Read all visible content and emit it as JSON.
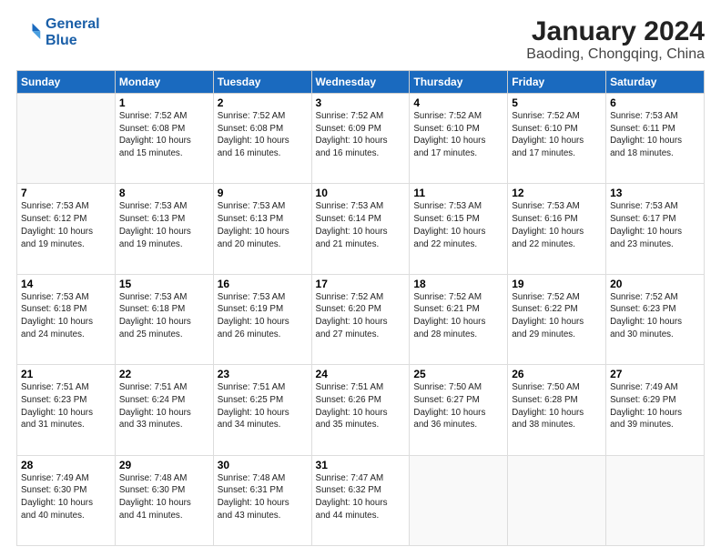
{
  "logo": {
    "line1": "General",
    "line2": "Blue"
  },
  "title": "January 2024",
  "subtitle": "Baoding, Chongqing, China",
  "weekdays": [
    "Sunday",
    "Monday",
    "Tuesday",
    "Wednesday",
    "Thursday",
    "Friday",
    "Saturday"
  ],
  "weeks": [
    [
      {
        "day": "",
        "info": ""
      },
      {
        "day": "1",
        "info": "Sunrise: 7:52 AM\nSunset: 6:08 PM\nDaylight: 10 hours\nand 15 minutes."
      },
      {
        "day": "2",
        "info": "Sunrise: 7:52 AM\nSunset: 6:08 PM\nDaylight: 10 hours\nand 16 minutes."
      },
      {
        "day": "3",
        "info": "Sunrise: 7:52 AM\nSunset: 6:09 PM\nDaylight: 10 hours\nand 16 minutes."
      },
      {
        "day": "4",
        "info": "Sunrise: 7:52 AM\nSunset: 6:10 PM\nDaylight: 10 hours\nand 17 minutes."
      },
      {
        "day": "5",
        "info": "Sunrise: 7:52 AM\nSunset: 6:10 PM\nDaylight: 10 hours\nand 17 minutes."
      },
      {
        "day": "6",
        "info": "Sunrise: 7:53 AM\nSunset: 6:11 PM\nDaylight: 10 hours\nand 18 minutes."
      }
    ],
    [
      {
        "day": "7",
        "info": "Sunrise: 7:53 AM\nSunset: 6:12 PM\nDaylight: 10 hours\nand 19 minutes."
      },
      {
        "day": "8",
        "info": "Sunrise: 7:53 AM\nSunset: 6:13 PM\nDaylight: 10 hours\nand 19 minutes."
      },
      {
        "day": "9",
        "info": "Sunrise: 7:53 AM\nSunset: 6:13 PM\nDaylight: 10 hours\nand 20 minutes."
      },
      {
        "day": "10",
        "info": "Sunrise: 7:53 AM\nSunset: 6:14 PM\nDaylight: 10 hours\nand 21 minutes."
      },
      {
        "day": "11",
        "info": "Sunrise: 7:53 AM\nSunset: 6:15 PM\nDaylight: 10 hours\nand 22 minutes."
      },
      {
        "day": "12",
        "info": "Sunrise: 7:53 AM\nSunset: 6:16 PM\nDaylight: 10 hours\nand 22 minutes."
      },
      {
        "day": "13",
        "info": "Sunrise: 7:53 AM\nSunset: 6:17 PM\nDaylight: 10 hours\nand 23 minutes."
      }
    ],
    [
      {
        "day": "14",
        "info": "Sunrise: 7:53 AM\nSunset: 6:18 PM\nDaylight: 10 hours\nand 24 minutes."
      },
      {
        "day": "15",
        "info": "Sunrise: 7:53 AM\nSunset: 6:18 PM\nDaylight: 10 hours\nand 25 minutes."
      },
      {
        "day": "16",
        "info": "Sunrise: 7:53 AM\nSunset: 6:19 PM\nDaylight: 10 hours\nand 26 minutes."
      },
      {
        "day": "17",
        "info": "Sunrise: 7:52 AM\nSunset: 6:20 PM\nDaylight: 10 hours\nand 27 minutes."
      },
      {
        "day": "18",
        "info": "Sunrise: 7:52 AM\nSunset: 6:21 PM\nDaylight: 10 hours\nand 28 minutes."
      },
      {
        "day": "19",
        "info": "Sunrise: 7:52 AM\nSunset: 6:22 PM\nDaylight: 10 hours\nand 29 minutes."
      },
      {
        "day": "20",
        "info": "Sunrise: 7:52 AM\nSunset: 6:23 PM\nDaylight: 10 hours\nand 30 minutes."
      }
    ],
    [
      {
        "day": "21",
        "info": "Sunrise: 7:51 AM\nSunset: 6:23 PM\nDaylight: 10 hours\nand 31 minutes."
      },
      {
        "day": "22",
        "info": "Sunrise: 7:51 AM\nSunset: 6:24 PM\nDaylight: 10 hours\nand 33 minutes."
      },
      {
        "day": "23",
        "info": "Sunrise: 7:51 AM\nSunset: 6:25 PM\nDaylight: 10 hours\nand 34 minutes."
      },
      {
        "day": "24",
        "info": "Sunrise: 7:51 AM\nSunset: 6:26 PM\nDaylight: 10 hours\nand 35 minutes."
      },
      {
        "day": "25",
        "info": "Sunrise: 7:50 AM\nSunset: 6:27 PM\nDaylight: 10 hours\nand 36 minutes."
      },
      {
        "day": "26",
        "info": "Sunrise: 7:50 AM\nSunset: 6:28 PM\nDaylight: 10 hours\nand 38 minutes."
      },
      {
        "day": "27",
        "info": "Sunrise: 7:49 AM\nSunset: 6:29 PM\nDaylight: 10 hours\nand 39 minutes."
      }
    ],
    [
      {
        "day": "28",
        "info": "Sunrise: 7:49 AM\nSunset: 6:30 PM\nDaylight: 10 hours\nand 40 minutes."
      },
      {
        "day": "29",
        "info": "Sunrise: 7:48 AM\nSunset: 6:30 PM\nDaylight: 10 hours\nand 41 minutes."
      },
      {
        "day": "30",
        "info": "Sunrise: 7:48 AM\nSunset: 6:31 PM\nDaylight: 10 hours\nand 43 minutes."
      },
      {
        "day": "31",
        "info": "Sunrise: 7:47 AM\nSunset: 6:32 PM\nDaylight: 10 hours\nand 44 minutes."
      },
      {
        "day": "",
        "info": ""
      },
      {
        "day": "",
        "info": ""
      },
      {
        "day": "",
        "info": ""
      }
    ]
  ]
}
